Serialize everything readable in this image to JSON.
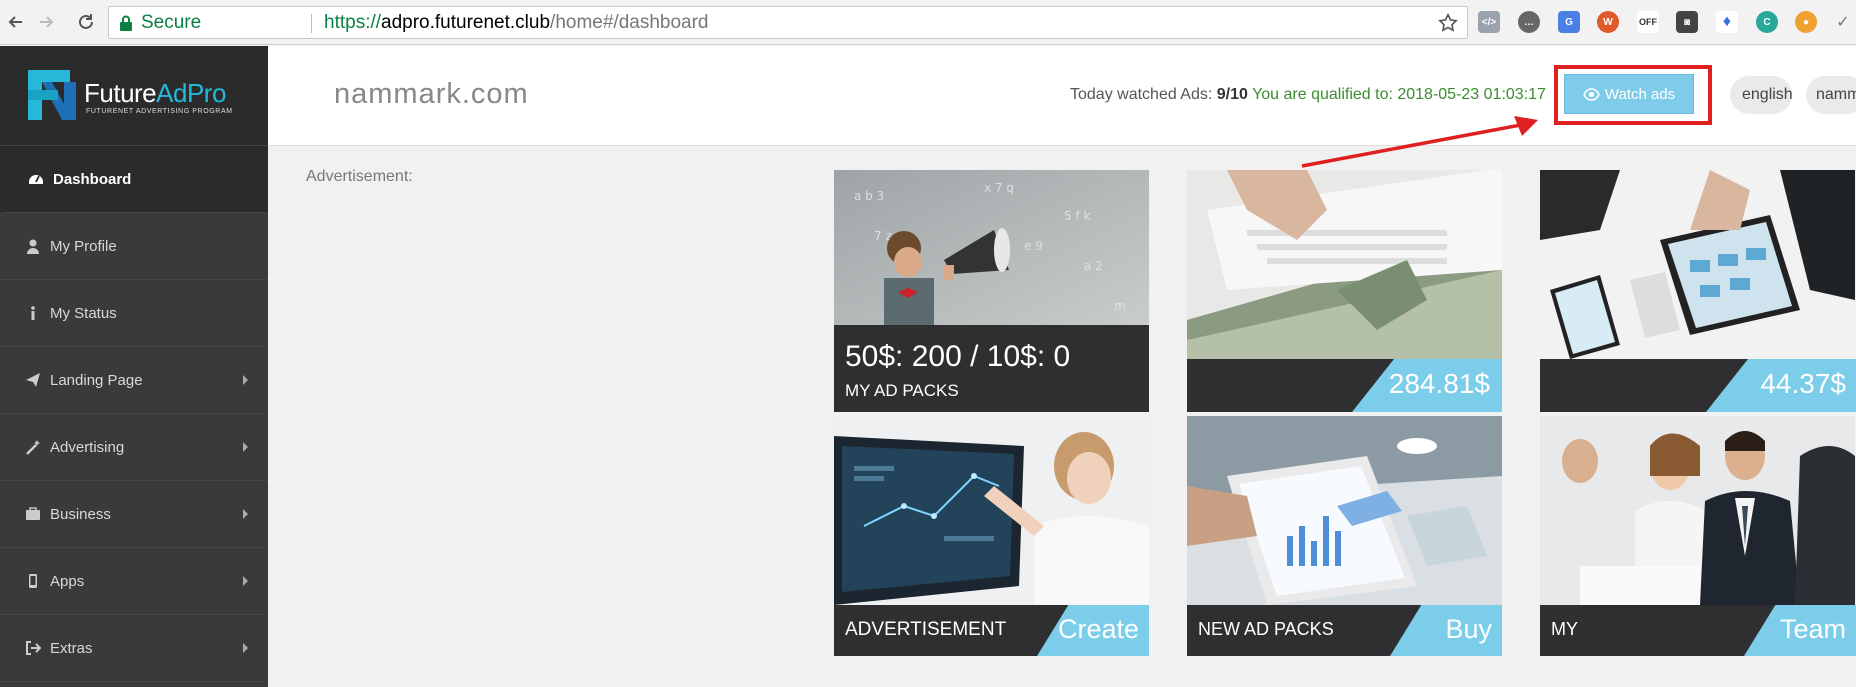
{
  "browser": {
    "secure_label": "Secure",
    "url_scheme": "https://",
    "url_host": "adpro.futurenet.club",
    "url_path": "/home#/dashboard",
    "extension_off_label": "OFF"
  },
  "brand": {
    "name_part1": "Future",
    "name_part2": "AdPro",
    "tagline": "FUTURENET ADVERTISING PROGRAM",
    "accent_color": "#25b8d8"
  },
  "sidebar": {
    "items": [
      {
        "label": "Dashboard",
        "icon": "dashboard-icon",
        "active": true
      },
      {
        "label": "My Profile",
        "icon": "user-icon"
      },
      {
        "label": "My Status",
        "icon": "info-icon"
      },
      {
        "label": "Landing Page",
        "icon": "paper-plane-icon",
        "has_submenu": true
      },
      {
        "label": "Advertising",
        "icon": "magic-wand-icon",
        "has_submenu": true
      },
      {
        "label": "Business",
        "icon": "briefcase-icon",
        "has_submenu": true
      },
      {
        "label": "Apps",
        "icon": "mobile-icon",
        "has_submenu": true
      },
      {
        "label": "Extras",
        "icon": "sign-out-icon",
        "has_submenu": true
      }
    ]
  },
  "header": {
    "site_name": "nammark.com",
    "watched_prefix": "Today watched Ads:",
    "watched_count": "9/10",
    "qualified_text": "You are qualified to: 2018-05-23 01:03:17",
    "watch_button": "Watch ads",
    "language": "english",
    "user": "namm"
  },
  "content": {
    "ad_label": "Advertisement:",
    "tiles": [
      {
        "title": "50$: 200 / 10$: 0",
        "subtitle": "MY AD PACKS"
      },
      {
        "amount": "284.81$"
      },
      {
        "amount": "44.37$"
      },
      {
        "label": "ADVERTISEMENT",
        "action": "Create"
      },
      {
        "label": "NEW AD PACKS",
        "action": "Buy"
      },
      {
        "label": "MY",
        "action": "Team"
      }
    ]
  },
  "colors": {
    "tile_accent": "#7ccdea",
    "tile_bar": "#2f2f31",
    "sidebar_bg": "#3a3a3a",
    "highlight_red": "#e02020"
  }
}
